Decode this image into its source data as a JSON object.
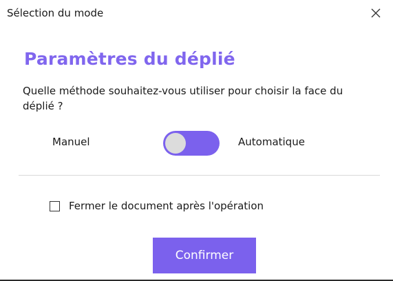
{
  "window": {
    "title": "Sélection du mode",
    "close_icon": "close-icon"
  },
  "content": {
    "heading": "Paramètres du déplié",
    "question": "Quelle méthode souhaitez-vous utiliser pour choisir la face du déplié ?",
    "mode_toggle": {
      "left_label": "Manuel",
      "right_label": "Automatique",
      "state": "off",
      "track_color": "#7b61ed",
      "knob_color": "#dcdcdc"
    },
    "close_after_checkbox": {
      "label": "Fermer le document après l'opération",
      "checked": false
    },
    "confirm_button": {
      "label": "Confirmer"
    }
  },
  "colors": {
    "accent": "#8066ee",
    "button": "#7b61ed",
    "divider": "#d9d9d9"
  }
}
